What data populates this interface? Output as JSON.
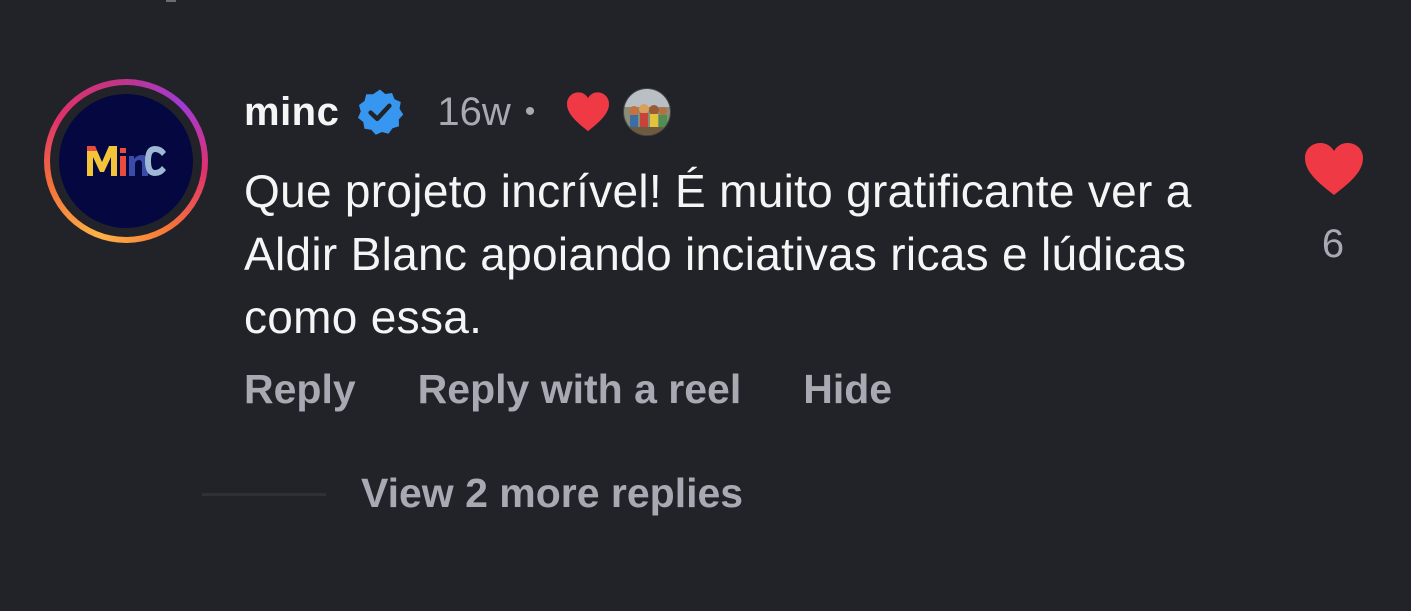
{
  "comment": {
    "username": "minc",
    "avatar_initials": "MinC",
    "verified_icon": "verified-badge-icon",
    "timestamp": "16w",
    "separator": "•",
    "creator_liked_icon": "heart-icon",
    "text": "Que projeto incrível! É muito gratificante ver a Aldir Blanc apoiando inciativas ricas e lúdicas como essa.",
    "like_count": "6",
    "actions": {
      "reply": "Reply",
      "reply_reel": "Reply with a reel",
      "hide": "Hide"
    },
    "view_replies": "View 2 more replies"
  },
  "colors": {
    "background": "#222329",
    "primary_text": "#f5f5f5",
    "secondary_text": "#a7aab3",
    "heart": "#ef3a45",
    "verified": "#3797f0",
    "avatar_bg": "#050740"
  }
}
